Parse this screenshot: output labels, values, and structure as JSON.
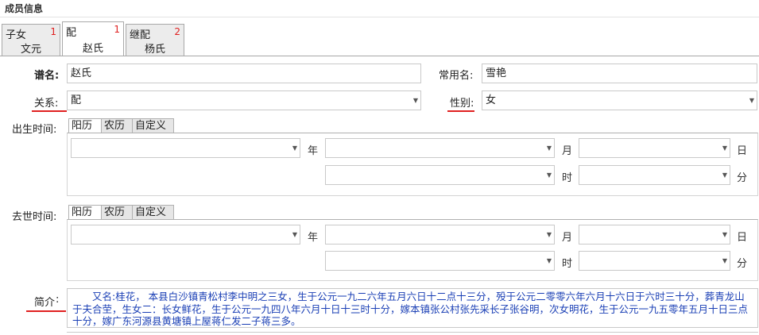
{
  "section": {
    "title": "成员信息"
  },
  "member_tabs": [
    {
      "line1": "子女",
      "line2": "文元",
      "count": "1"
    },
    {
      "line1": "配",
      "line2": "赵氏",
      "count": "1"
    },
    {
      "line1": "继配",
      "line2": "杨氏",
      "count": "2"
    }
  ],
  "form": {
    "genealogy_name_label": "谱名:",
    "genealogy_name_value": "赵氏",
    "common_name_label": "常用名:",
    "common_name_value": "雪艳",
    "relation_label": "关系:",
    "relation_value": "配",
    "gender_label": "性别:",
    "gender_value": "女",
    "birth_label": "出生时间:",
    "death_label": "去世时间:",
    "bio_label": "简介",
    "bio_colon": ":",
    "bio_text": "　　又名:桂花， 本县白沙镇青松村李中明之三女，生于公元一九二六年五月六日十二点十三分，殁于公元二零零六年六月十六日于六时三十分，葬青龙山于夫合茔，生女二：长女鲜花，生于公元一九四八年六月十日十三时十分，嫁本镇张公村张先采长子张谷明，次女明花，生于公元一九五零年五月十日三点十分，嫁广东河源县黄塘镇上屋蒋仁发二子蒋三多。"
  },
  "date_tabs": {
    "solar": "阳历",
    "lunar": "农历",
    "custom": "自定义"
  },
  "units": {
    "year": "年",
    "month": "月",
    "day": "日",
    "hour": "时",
    "minute": "分"
  },
  "colors": {
    "accent_red": "#e02020",
    "bio_text": "#1a3fb5"
  },
  "icons": {
    "dropdown": "dropdown-arrow-icon"
  }
}
